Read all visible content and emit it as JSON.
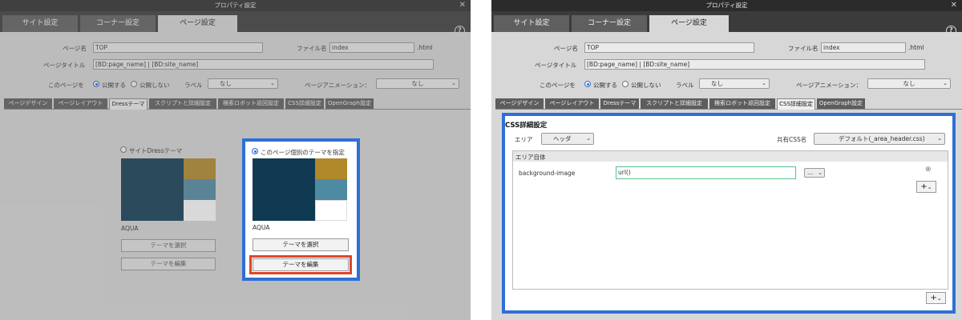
{
  "window": {
    "title": "プロパティ設定"
  },
  "top_tabs": [
    "サイト設定",
    "コーナー設定",
    "ページ設定"
  ],
  "form": {
    "page_name_label": "ページ名",
    "page_name_value": "TOP",
    "file_name_label": "ファイル名",
    "file_name_value": "index",
    "file_ext": ".html",
    "page_title_label": "ページタイトル",
    "page_title_value": "[BD:page_name] | [BD:site_name]",
    "publish_label": "このページを",
    "publish_on": "公開する",
    "publish_off": "公開しない",
    "label_label": "ラベル",
    "label_value": "なし",
    "animation_label": "ページアニメーション：",
    "animation_value": "なし"
  },
  "sub_tabs": [
    "ページデザイン",
    "ページレイアウト",
    "Dressテーマ",
    "スクリプトと詳細設定",
    "検索ロボット巡回設定",
    "CSS詳細設定",
    "OpenGraph設定"
  ],
  "dress": {
    "site_theme_label": "サイトDressテーマ",
    "site_theme_name": "AQUA",
    "page_theme_label": "このページ個別のテーマを指定",
    "page_theme_name": "AQUA",
    "select_button": "テーマを選択",
    "edit_button": "テーマを編集",
    "colors": {
      "main": "#0f3a52",
      "gold": "#b1882a",
      "teal": "#4f8aa3",
      "white": "#ffffff",
      "highlight_blue": "#2f6fd6",
      "highlight_red": "#e0452a"
    }
  },
  "css": {
    "title": "CSS詳細設定",
    "area_label": "エリア",
    "area_value": "ヘッダ",
    "shared_css_label": "共有CSS名",
    "shared_css_value": "デフォルト(_area_header.css)",
    "section_title": "エリア自体",
    "property_name": "background-image",
    "property_value": "url()",
    "dots_button": "...",
    "plus_button": "+"
  },
  "icons": {
    "close": "close-icon",
    "help": "help-icon",
    "chevron": "chevron-down-icon",
    "remove": "remove-circle-icon"
  }
}
